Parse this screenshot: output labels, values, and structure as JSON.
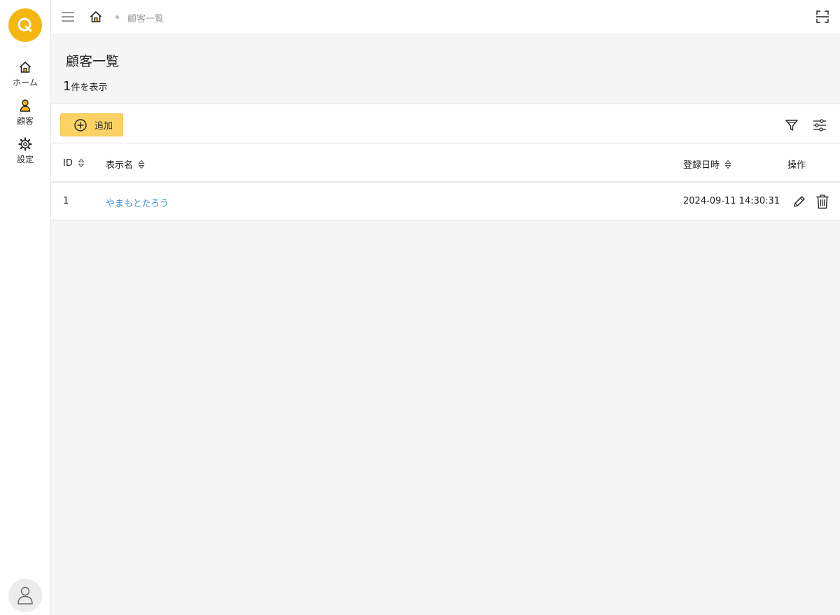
{
  "sidebar": {
    "logo_letter": "Q",
    "items": [
      {
        "label": "ホーム",
        "icon": "home-icon"
      },
      {
        "label": "顧客",
        "icon": "person-icon"
      },
      {
        "label": "設定",
        "icon": "gear-icon"
      }
    ],
    "avatar_icon": "user-avatar-icon"
  },
  "topbar": {
    "breadcrumb_current": "顧客一覧"
  },
  "page": {
    "title": "顧客一覧",
    "count": "1",
    "count_suffix": "件を表示"
  },
  "toolbar": {
    "add_label": "追加"
  },
  "table": {
    "columns": [
      {
        "label": "ID",
        "sortable": true
      },
      {
        "label": "表示名",
        "sortable": true
      },
      {
        "label": "登録日時",
        "sortable": true
      },
      {
        "label": "操作",
        "sortable": false
      }
    ],
    "rows": [
      {
        "id": "1",
        "name": "やまもとたろう",
        "registered": "2024-09-11 14:30:31"
      }
    ]
  },
  "colors": {
    "accent": "#f5b70f",
    "button_bg": "#fcd264",
    "link": "#3a8fd8"
  }
}
